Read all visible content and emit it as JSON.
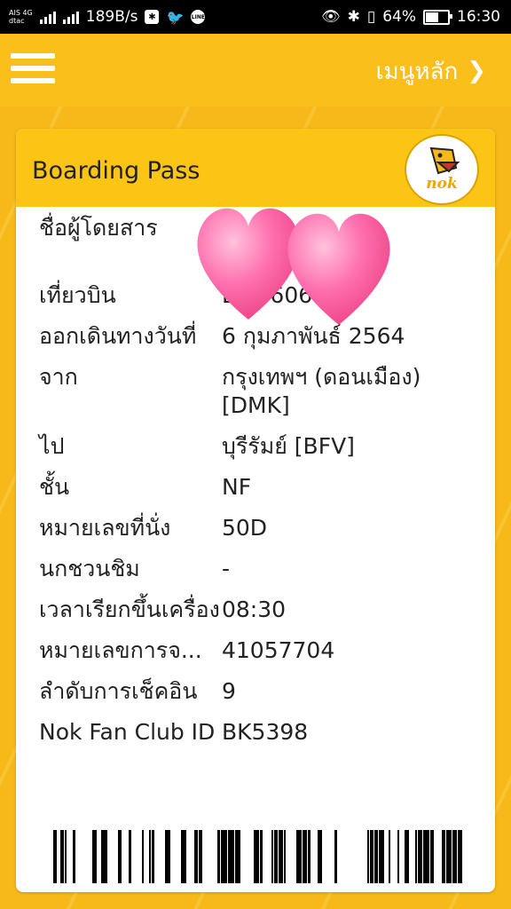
{
  "status_bar": {
    "carrier_top": "AIS 4G",
    "carrier_bottom": "dtac",
    "speed": "189B/s",
    "battery": "64%",
    "battery_level": 0.64,
    "time": "16:30",
    "line_app_label": "LINE"
  },
  "app_bar": {
    "menu_label": "เมนูหลัก",
    "menu_arrow": "❯"
  },
  "card": {
    "title": "Boarding Pass",
    "logo_text": "nok",
    "rows": [
      {
        "label": "ชื่อผู้โดยสาร",
        "value": ""
      },
      {
        "label": "เที่ยวบิน",
        "value": "DD9606"
      },
      {
        "label": "ออกเดินทางวันที่",
        "value": "6 กุมภาพันธ์ 2564"
      },
      {
        "label": "จาก",
        "value": "กรุงเทพฯ (ดอนเมือง) [DMK]"
      },
      {
        "label": "ไป",
        "value": "บุรีรัมย์ [BFV]"
      },
      {
        "label": "ชั้น",
        "value": "NF"
      },
      {
        "label": "หมายเลขที่นั่ง",
        "value": "50D"
      },
      {
        "label": "นกชวนชิม",
        "value": "-"
      },
      {
        "label": "เวลาเรียกขึ้นเครื่อง",
        "value": "08:30"
      },
      {
        "label": "หมายเลขการจ...",
        "value": "41057704"
      },
      {
        "label": "ลำดับการเช็คอิน",
        "value": "9"
      },
      {
        "label": "Nok Fan Club ID",
        "value": "BK5398"
      }
    ]
  },
  "colors": {
    "brand_yellow": "#fbbf1c",
    "header_yellow": "#fcc516",
    "heart_pink": "#ff5fa0"
  }
}
